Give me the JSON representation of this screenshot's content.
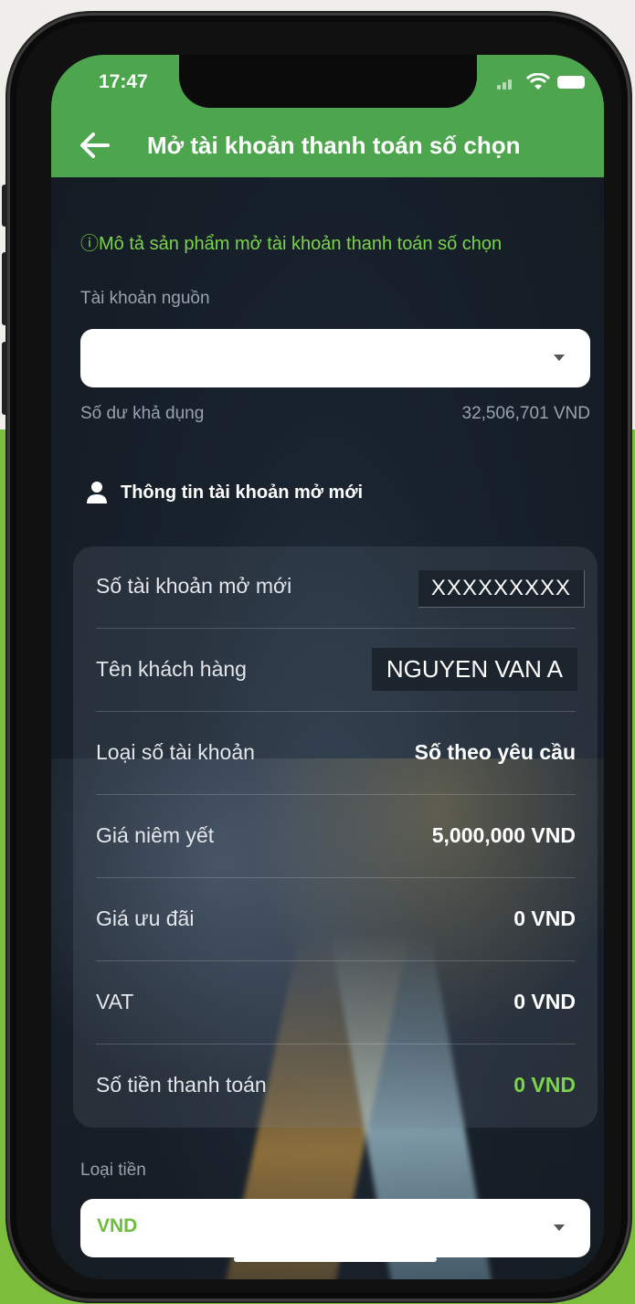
{
  "status_bar": {
    "time": "17:47"
  },
  "header": {
    "title": "Mở tài khoản thanh toán số chọn"
  },
  "description_link": "ⓘMô tả sản phẩm mở tài khoản thanh toán số chọn",
  "source_account": {
    "label": "Tài khoản nguồn",
    "value": "",
    "balance_label": "Số dư khả dụng",
    "balance_value": "32,506,701 VND"
  },
  "new_account_section": {
    "title": "Thông tin tài khoản mở mới"
  },
  "details": [
    {
      "label": "Số tài khoản mở mới",
      "value": "XXXXXXXXX"
    },
    {
      "label": "Tên khách hàng",
      "value": "NGUYEN VAN A"
    },
    {
      "label": "Loại số tài khoản",
      "value": "Số theo yêu cầu"
    },
    {
      "label": "Giá niêm yết",
      "value": "5,000,000 VND"
    },
    {
      "label": "Giá ưu đãi",
      "value": "0 VND"
    },
    {
      "label": "VAT",
      "value": "0 VND"
    },
    {
      "label": "Số tiền thanh toán",
      "value": "0 VND"
    }
  ],
  "currency": {
    "label": "Loại tiền",
    "value": "VND"
  },
  "colors": {
    "header_green": "#4da64d",
    "accent_green": "#7bd34c",
    "outer_green": "#7cbd3c"
  },
  "icons": [
    "back-arrow-icon",
    "info-icon",
    "user-icon",
    "dropdown-caret-icon",
    "signal-icon",
    "wifi-icon",
    "battery-icon"
  ]
}
